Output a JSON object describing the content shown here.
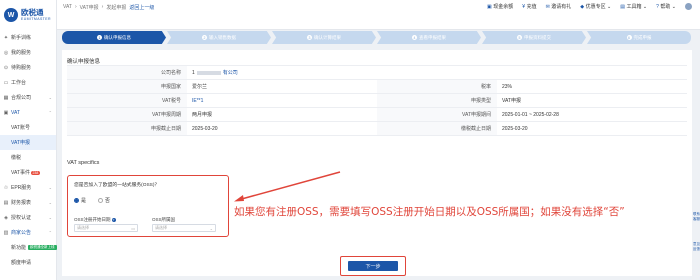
{
  "brand": {
    "logo_mark": "W",
    "name": "欧税通",
    "tagline": "EUMITMASTER"
  },
  "sidebar": {
    "items": [
      {
        "icon": "rocket-icon",
        "label": "新手训练"
      },
      {
        "icon": "service-icon",
        "label": "我的服务"
      },
      {
        "icon": "cart-icon",
        "label": "待购服务"
      },
      {
        "icon": "desk-icon",
        "label": "工作台"
      },
      {
        "icon": "company-icon",
        "label": "合规公司"
      },
      {
        "icon": "vat-icon",
        "label": "VAT"
      },
      {
        "icon": "",
        "label": "VAT账号"
      },
      {
        "icon": "",
        "label": "VAT申报"
      },
      {
        "icon": "",
        "label": "缴税"
      },
      {
        "icon": "",
        "label": "VAT事件",
        "badge": "238"
      },
      {
        "icon": "epr-icon",
        "label": "EPR服务"
      },
      {
        "icon": "report-icon",
        "label": "财务报表"
      },
      {
        "icon": "auth-icon",
        "label": "授权认证"
      },
      {
        "icon": "store-icon",
        "label": "商家公告"
      },
      {
        "icon": "",
        "label": "新功能",
        "badge": "欧税通全新上线"
      },
      {
        "icon": "",
        "label": "额度申请"
      }
    ]
  },
  "breadcrumb": {
    "a": "VAT",
    "b": "VAT申报",
    "c": "发起申报",
    "back": "返回上一级"
  },
  "topbar": {
    "tool1": "现金余额",
    "tool2": "充值",
    "tool3": "邀请有礼",
    "tool4": "优惠专区",
    "tool5": "工具箱",
    "tool6": "帮助"
  },
  "steps": [
    {
      "num": "1",
      "label": "确认申报信息"
    },
    {
      "num": "2",
      "label": "输入销售数据"
    },
    {
      "num": "3",
      "label": "确认计算结果"
    },
    {
      "num": "4",
      "label": "查看申报结果"
    },
    {
      "num": "5",
      "label": "申报资料提交"
    },
    {
      "num": "6",
      "label": "完成申报"
    }
  ],
  "confirm": {
    "title": "确认申报信息",
    "company_label": "公司名称",
    "company_prefix": "1",
    "company_suffix": "有公司",
    "country_label": "申报国家",
    "country_value": "爱尔兰",
    "rate_label": "税率",
    "rate_value": "23%",
    "vatno_label": "VAT税号",
    "vatno_value": "IE**1",
    "type_label": "申报类型",
    "type_value": "VAT申报",
    "cycle_label": "VAT申报周期",
    "cycle_value": "两月申报",
    "period_label": "VAT申报期间",
    "period_value": "2025-01-01 ~ 2025-02-28",
    "deadline_label": "申报截止日期",
    "deadline_value": "2025-03-20",
    "pay_deadline_label": "缴税截止日期",
    "pay_deadline_value": "2025-03-20"
  },
  "vat_specifics": {
    "title": "VAT specifics",
    "question": "您是否加入了欧盟的一站式服务(OSS)？",
    "yes": "是",
    "no": "否",
    "selected": "yes",
    "start_label": "OSS注册开始日期",
    "start_placeholder": "请选择",
    "country_label": "OSS所属国",
    "country_placeholder": "请选择"
  },
  "annotation": "如果您有注册OSS，需要填写OSS注册开始日期以及OSS所属国；如果没有选择“否”",
  "next_button": "下一步",
  "right_rail": {
    "a": "联系客服",
    "b": "意见反馈"
  }
}
